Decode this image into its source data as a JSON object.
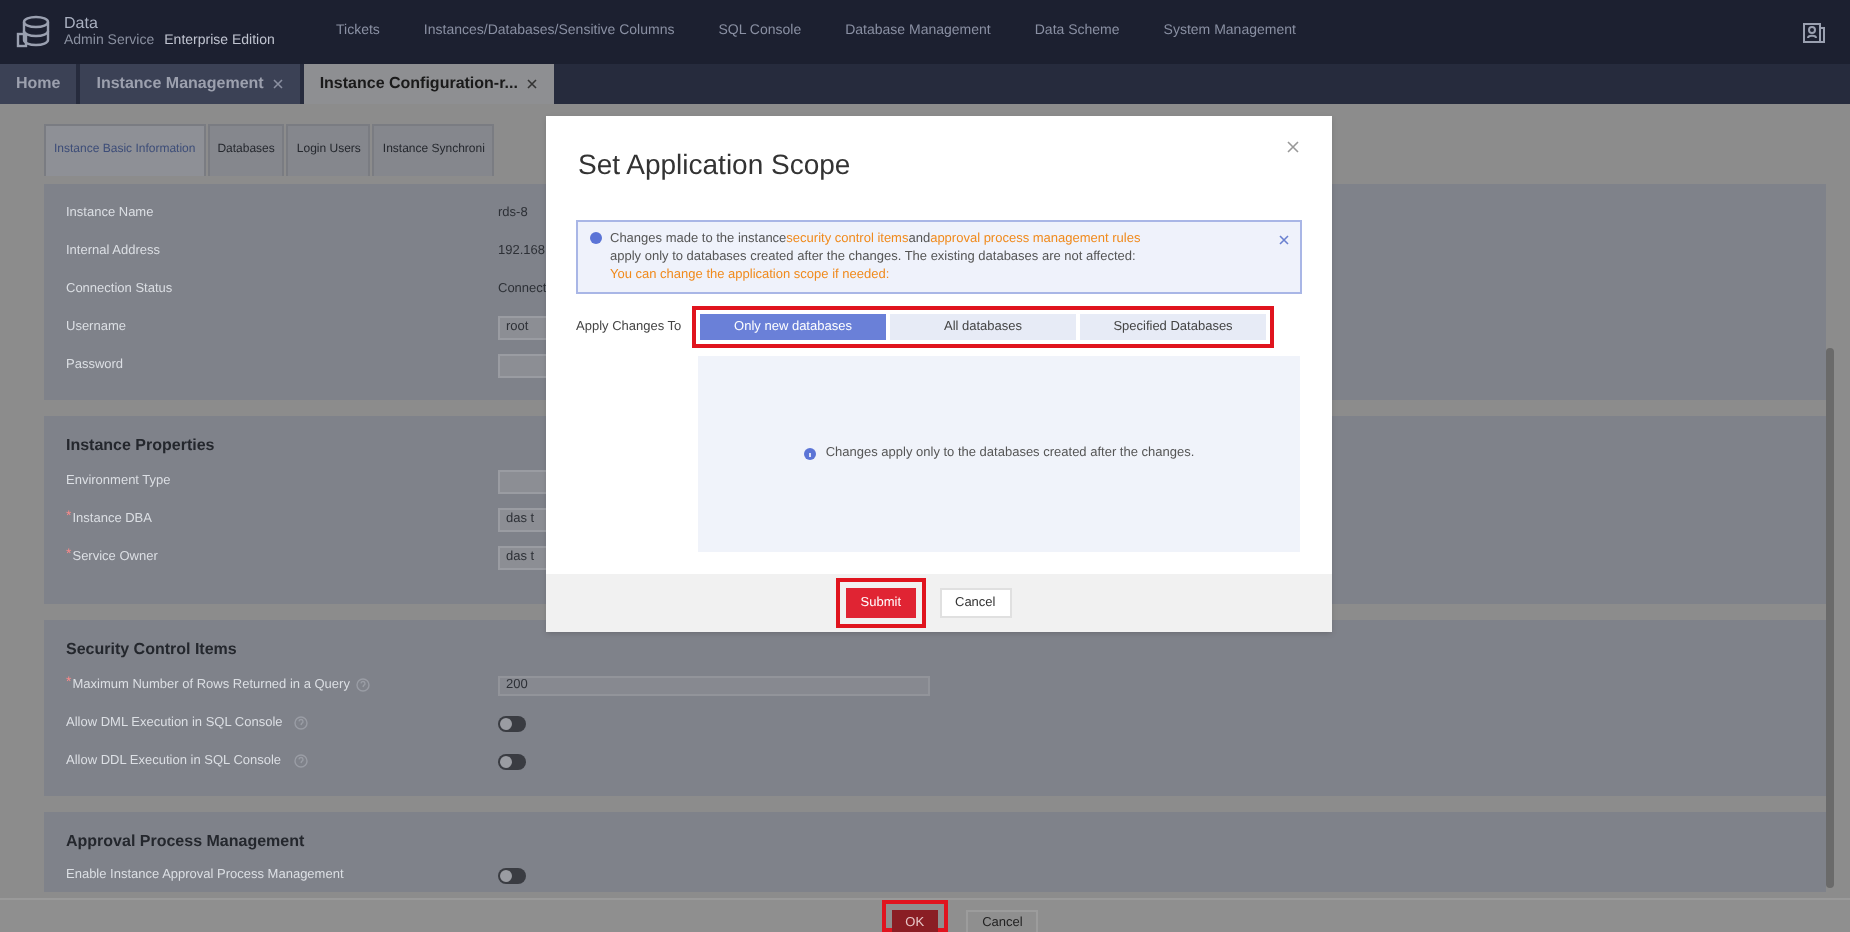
{
  "nav": {
    "logo": {
      "title": "Data",
      "subtitle": "Admin Service",
      "edition": "Enterprise Edition"
    },
    "items": [
      "Tickets",
      "Instances/Databases/Sensitive Columns",
      "SQL Console",
      "Database Management",
      "Data Scheme",
      "System Management"
    ]
  },
  "page_tabs": [
    {
      "label": "Home",
      "closable": false,
      "selected": false
    },
    {
      "label": "Instance Management",
      "closable": true,
      "selected": false
    },
    {
      "label": "Instance Configuration-r...",
      "closable": true,
      "selected": true
    }
  ],
  "section_tabs": [
    {
      "label": "Instance Basic Information",
      "selected": true
    },
    {
      "label": "Databases",
      "selected": false
    },
    {
      "label": "Login Users",
      "selected": false
    },
    {
      "label": "Instance Synchroni",
      "selected": false
    }
  ],
  "sections": [
    {
      "fields": [
        {
          "label": "Instance Name",
          "kind": "text",
          "value": "rds-8"
        },
        {
          "label": "Internal Address",
          "kind": "text",
          "value": "192.168"
        },
        {
          "label": "Connection Status",
          "kind": "text",
          "value": "Connect"
        },
        {
          "label": "Username",
          "kind": "input",
          "value": "root"
        },
        {
          "label": "Password",
          "kind": "input"
        }
      ]
    },
    {
      "title": "Instance Properties",
      "fields": [
        {
          "label": "Environment Type",
          "kind": "input"
        },
        {
          "label": "Instance DBA",
          "required_mark": "*",
          "kind": "input",
          "value": "das t"
        },
        {
          "label": "Service Owner",
          "required_mark": "*",
          "kind": "input",
          "value": "das t"
        }
      ]
    },
    {
      "title": "Security Control Items",
      "fields": [
        {
          "label": "Maximum Number of Rows Returned in a Query",
          "required_mark": "*",
          "help": true,
          "kind": "wide_input",
          "value": "200"
        },
        {
          "label": "Allow DML Execution in SQL Console",
          "help": true,
          "kind": "toggle",
          "on": false
        },
        {
          "label": "Allow DDL Execution in SQL Console",
          "help": true,
          "kind": "toggle",
          "on": false
        }
      ]
    },
    {
      "title": "Approval Process Management",
      "fields": [
        {
          "label": "Enable Instance Approval Process Management",
          "kind": "toggle",
          "on": false
        }
      ]
    }
  ],
  "footer": {
    "buttons": [
      {
        "label": "OK",
        "kind": "primary",
        "highlighted": true
      },
      {
        "label": "Cancel",
        "kind": "secondary",
        "highlighted": false
      }
    ]
  },
  "dialog": {
    "title": "Set Application Scope",
    "notice": {
      "segments": [
        {
          "kind": "plain",
          "text": "Changes made to the instance"
        },
        {
          "kind": "link",
          "text": "security control items"
        },
        {
          "kind": "plain",
          "text": "and"
        },
        {
          "kind": "link",
          "text": "approval process management rules"
        },
        {
          "kind": "break"
        },
        {
          "kind": "plain",
          "text": "apply only to databases created after the changes. The existing databases are not affected:"
        }
      ],
      "hint": "You can change the application scope if needed:"
    },
    "scope": {
      "label": "Apply Changes To",
      "highlighted": true,
      "options": [
        {
          "label": "Only new databases",
          "selected": true
        },
        {
          "label": "All databases",
          "selected": false
        },
        {
          "label": "Specified Databases",
          "selected": false
        }
      ]
    },
    "message": "Changes apply only to the databases created after the changes.",
    "buttons": [
      {
        "label": "Submit",
        "kind": "primary",
        "highlighted": true
      },
      {
        "label": "Cancel",
        "kind": "secondary",
        "highlighted": false
      }
    ]
  }
}
